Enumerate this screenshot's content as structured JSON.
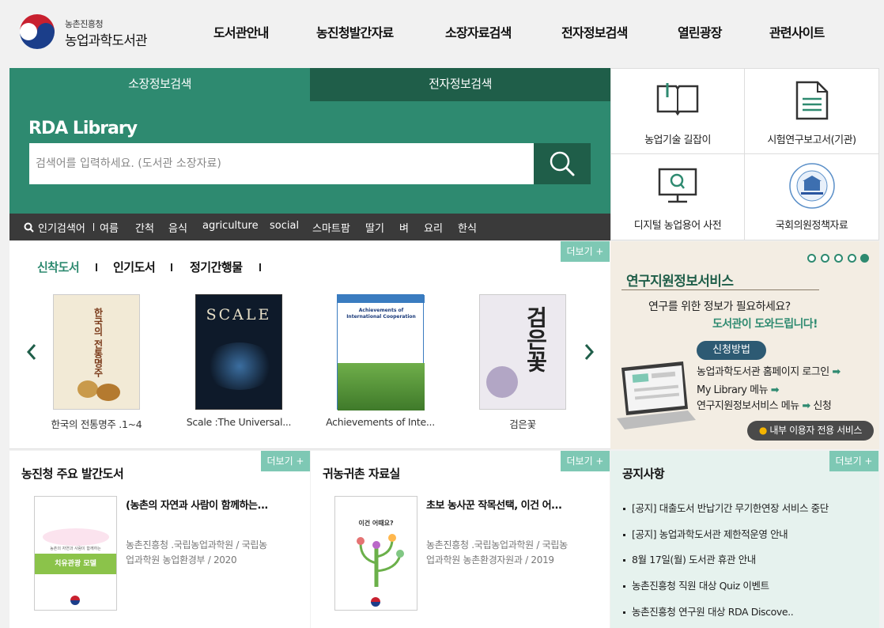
{
  "header": {
    "logo_small": "농촌진흥청",
    "logo_big": "농업과학도서관",
    "nav": [
      "도서관안내",
      "농진청발간자료",
      "소장자료검색",
      "전자정보검색",
      "열린광장",
      "관련사이트"
    ]
  },
  "search": {
    "tabs": [
      "소장정보검색",
      "전자정보검색"
    ],
    "title": "RDA Library",
    "placeholder": "검색어를 입력하세요. (도서관 소장자료)",
    "popular_label": "인기검색어",
    "popular": [
      "여름",
      "간척",
      "음식",
      "agriculture",
      "social",
      "스마트팜",
      "딸기",
      "벼",
      "요리",
      "한식"
    ]
  },
  "quick": [
    "농업기술 길잡이",
    "시험연구보고서(기관)",
    "디지털 농업용어 사전",
    "국회의원정책자료"
  ],
  "books": {
    "tabs": [
      "신착도서",
      "인기도서",
      "정기간행물"
    ],
    "more": "더보기 +",
    "items": [
      {
        "title": "한국의 전통명주 .1~4",
        "cover_text": "한국의 전통명주"
      },
      {
        "title": "Scale :The Universal...",
        "cover_text": "SCALE"
      },
      {
        "title": "Achievements of Inte...",
        "cover_text": "Achievements of International Cooperation"
      },
      {
        "title": "검은꽃",
        "cover_text": "검은꽃"
      }
    ]
  },
  "banner": {
    "title": "연구지원정보서비스",
    "line1": "연구를 위한 정보가 필요하세요?",
    "line2": "도서관이 도와드립니다!",
    "pill": "신청방법",
    "steps": [
      "농업과학도서관 홈페이지 로그인",
      "My Library 메뉴",
      "연구지원정보서비스 메뉴",
      "신청"
    ],
    "badge": "내부 이용자 전용 서비스"
  },
  "pub1": {
    "heading": "농진청 주요 발간도서",
    "more": "더보기 +",
    "title": "(농촌의 자연과 사람이 함께하는...",
    "meta1": "농촌진흥청 .국립농업과학원 / 국립농",
    "meta2": "업과학원 농업환경부 / 2020",
    "cover_line": "농촌의 자연과 사람이 함께하는",
    "cover_title": "치유관광 모델"
  },
  "pub2": {
    "heading": "귀농귀촌 자료실",
    "more": "더보기 +",
    "title": "초보 농사꾼 작목선택, 이건 어...",
    "meta1": "농촌진흥청 .국립농업과학원 / 국립농",
    "meta2": "업과학원 농촌환경자원과 / 2019",
    "cover_title": "이건 어때요?"
  },
  "notice": {
    "heading": "공지사항",
    "more": "더보기 +",
    "items": [
      "[공지] 대출도서 반납기간 무기한연장 서비스 중단",
      "[공지] 농업과학도서관 제한적운영 안내",
      "8월 17일(월) 도서관 휴관 안내",
      "농촌진흥청 직원 대상 Quiz 이벤트",
      "농촌진흥청 연구원 대상 RDA Discove.."
    ]
  },
  "colors": {
    "green": "#2e8a70",
    "dark_green": "#1f5e49",
    "mint": "#7ec8b4",
    "pop_bar": "#3a3a3a"
  }
}
